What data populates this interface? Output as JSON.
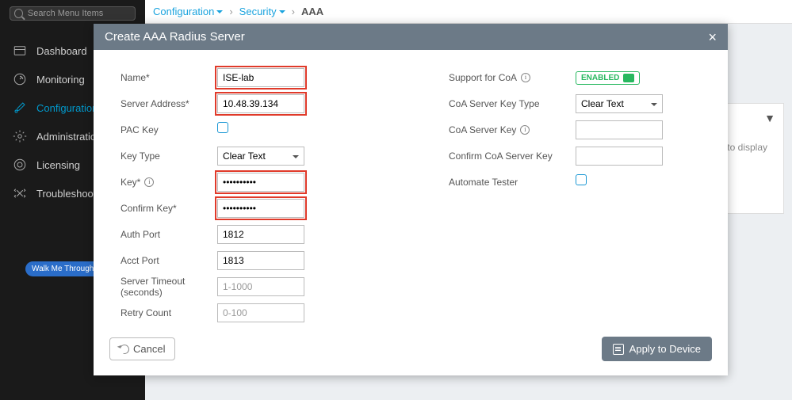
{
  "sidebar": {
    "search_placeholder": "Search Menu Items",
    "items": [
      {
        "label": "Dashboard"
      },
      {
        "label": "Monitoring"
      },
      {
        "label": "Configuration"
      },
      {
        "label": "Administration"
      },
      {
        "label": "Licensing"
      },
      {
        "label": "Troubleshooting"
      }
    ],
    "walk_label": "Walk Me Through >"
  },
  "breadcrumb": {
    "items": [
      "Configuration",
      "Security",
      "AAA"
    ]
  },
  "bg_panel": {
    "no_items": "items to display"
  },
  "modal": {
    "title": "Create AAA Radius Server",
    "cancel_label": "Cancel",
    "apply_label": "Apply to Device",
    "left": {
      "name_label": "Name*",
      "name_value": "ISE-lab",
      "server_addr_label": "Server Address*",
      "server_addr_value": "10.48.39.134",
      "pac_key_label": "PAC Key",
      "key_type_label": "Key Type",
      "key_type_value": "Clear Text",
      "key_label": "Key*",
      "key_value": "••••••••••",
      "confirm_key_label": "Confirm Key*",
      "confirm_key_value": "••••••••••",
      "auth_port_label": "Auth Port",
      "auth_port_value": "1812",
      "acct_port_label": "Acct Port",
      "acct_port_value": "1813",
      "server_timeout_label": "Server Timeout (seconds)",
      "server_timeout_placeholder": "1-1000",
      "retry_count_label": "Retry Count",
      "retry_count_placeholder": "0-100"
    },
    "right": {
      "support_coa_label": "Support for CoA",
      "support_coa_value": "ENABLED",
      "coa_key_type_label": "CoA Server Key Type",
      "coa_key_type_value": "Clear Text",
      "coa_key_label": "CoA Server Key",
      "confirm_coa_key_label": "Confirm CoA Server Key",
      "automate_tester_label": "Automate Tester"
    }
  }
}
